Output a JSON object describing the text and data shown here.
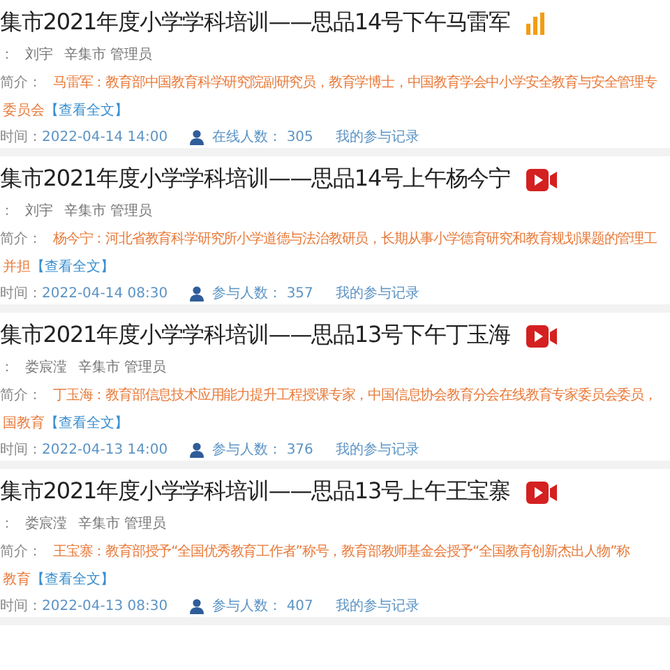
{
  "courses": [
    {
      "title": "集市2021年度小学学科培训——思品14号下午马雷军",
      "kind": "live",
      "host_label": "：",
      "host": "刘宇",
      "org": "辛集市 管理员",
      "desc_label": "简介：",
      "desc": "马雷军：教育部中国教育科学研究院副研究员，教育学博士，中国教育学会中小学安全教育与安全管理专",
      "desc_cont": "委员会",
      "more": "【查看全文】",
      "time_label": "时间：",
      "time": "2022-04-14 14:00",
      "count_label": "在线人数：",
      "count": "305",
      "record": "我的参与记录"
    },
    {
      "title": "集市2021年度小学学科培训——思品14号上午杨今宁",
      "kind": "video",
      "host_label": "：",
      "host": "刘宇",
      "org": "辛集市 管理员",
      "desc_label": "简介：",
      "desc": "杨今宁：河北省教育科学研究所小学道德与法治教研员，长期从事小学德育研究和教育规划课题的管理工",
      "desc_cont": "并担",
      "more": "【查看全文】",
      "time_label": "时间：",
      "time": "2022-04-14 08:30",
      "count_label": "参与人数：",
      "count": "357",
      "record": "我的参与记录"
    },
    {
      "title": "集市2021年度小学学科培训——思品13号下午丁玉海",
      "kind": "video",
      "host_label": "：",
      "host": "娄宸滢",
      "org": "辛集市 管理员",
      "desc_label": "简介：",
      "desc": "丁玉海：教育部信息技术应用能力提升工程授课专家，中国信息协会教育分会在线教育专家委员会委员，",
      "desc_cont": "国教育",
      "more": "【查看全文】",
      "time_label": "时间：",
      "time": "2022-04-13 14:00",
      "count_label": "参与人数：",
      "count": "376",
      "record": "我的参与记录"
    },
    {
      "title": "集市2021年度小学学科培训——思品13号上午王宝寨",
      "kind": "video",
      "host_label": "：",
      "host": "娄宸滢",
      "org": "辛集市 管理员",
      "desc_label": "简介：",
      "desc": "王宝寨：教育部授予“全国优秀教育工作者”称号，教育部教师基金会授予“全国教育创新杰出人物”称",
      "desc_cont": "教育",
      "more": "【查看全文】",
      "time_label": "时间：",
      "time": "2022-04-13 08:30",
      "count_label": "参与人数：",
      "count": "407",
      "record": "我的参与记录"
    }
  ]
}
